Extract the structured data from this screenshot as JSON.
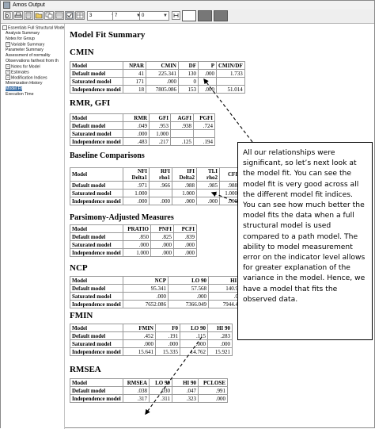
{
  "window": {
    "title": "Amos Output"
  },
  "toolbar": {
    "select1": "3",
    "select2": "7",
    "select3": "0"
  },
  "tree": [
    {
      "label": "Essentials Full Structural Model.a",
      "indent": 0,
      "expander": "-"
    },
    {
      "label": "Analysis Summary",
      "indent": 1,
      "expander": ""
    },
    {
      "label": "Notes for Group",
      "indent": 1,
      "expander": ""
    },
    {
      "label": "Variable Summary",
      "indent": 1,
      "expander": "+"
    },
    {
      "label": "Parameter Summary",
      "indent": 1,
      "expander": ""
    },
    {
      "label": "Assessment of normality",
      "indent": 1,
      "expander": ""
    },
    {
      "label": "Observations farthest from th",
      "indent": 1,
      "expander": ""
    },
    {
      "label": "Notes for Model",
      "indent": 1,
      "expander": "+"
    },
    {
      "label": "Estimates",
      "indent": 1,
      "expander": "+"
    },
    {
      "label": "Modification Indices",
      "indent": 1,
      "expander": "+"
    },
    {
      "label": "Minimization History",
      "indent": 1,
      "expander": ""
    },
    {
      "label": "Model Fit",
      "indent": 1,
      "expander": "",
      "selected": true
    },
    {
      "label": "Execution Time",
      "indent": 1,
      "expander": ""
    }
  ],
  "content": {
    "title": "Model Fit Summary",
    "sections": [
      {
        "heading": "CMIN",
        "columns": [
          "Model",
          "NPAR",
          "CMIN",
          "DF",
          "P",
          "CMIN/DF"
        ],
        "rows": [
          [
            "Default model",
            "41",
            "225.341",
            "130",
            ".000",
            "1.733"
          ],
          [
            "Saturated model",
            "171",
            ".000",
            "0",
            "",
            ""
          ],
          [
            "Independence model",
            "18",
            "7805.086",
            "153",
            ".000",
            "51.014"
          ]
        ]
      },
      {
        "heading": "RMR, GFI",
        "columns": [
          "Model",
          "RMR",
          "GFI",
          "AGFI",
          "PGFI"
        ],
        "rows": [
          [
            "Default model",
            ".049",
            ".953",
            ".938",
            ".724"
          ],
          [
            "Saturated model",
            ".000",
            "1.000",
            "",
            ""
          ],
          [
            "Independence model",
            ".483",
            ".217",
            ".125",
            ".194"
          ]
        ]
      },
      {
        "heading": "Baseline Comparisons",
        "columns": [
          "Model",
          "NFI\nDelta1",
          "RFI\nrho1",
          "IFI\nDelta2",
          "TLI\nrho2",
          "CFI"
        ],
        "rows": [
          [
            "Default model",
            ".971",
            ".966",
            ".988",
            ".985",
            ".988"
          ],
          [
            "Saturated model",
            "1.000",
            "",
            "1.000",
            "",
            "1.000"
          ],
          [
            "Independence model",
            ".000",
            ".000",
            ".000",
            ".000",
            ".000"
          ]
        ]
      },
      {
        "heading": "Parsimony-Adjusted Measures",
        "columns": [
          "Model",
          "PRATIO",
          "PNFI",
          "PCFI"
        ],
        "rows": [
          [
            "Default model",
            ".850",
            ".825",
            ".839"
          ],
          [
            "Saturated model",
            ".000",
            ".000",
            ".000"
          ],
          [
            "Independence model",
            "1.000",
            ".000",
            ".000"
          ]
        ]
      },
      {
        "heading": "NCP",
        "columns": [
          "Model",
          "NCP",
          "LO 90",
          "HI 90"
        ],
        "rows": [
          [
            "Default model",
            "95.341",
            "57.568",
            "140.981"
          ],
          [
            "Saturated model",
            ".000",
            ".000",
            ".000"
          ],
          [
            "Independence model",
            "7652.086",
            "7366.049",
            "7944.441"
          ]
        ]
      },
      {
        "heading": "FMIN",
        "columns": [
          "Model",
          "FMIN",
          "F0",
          "LO 90",
          "HI 90"
        ],
        "rows": [
          [
            "Default model",
            ".452",
            ".191",
            ".115",
            ".283"
          ],
          [
            "Saturated model",
            ".000",
            ".000",
            ".000",
            ".000"
          ],
          [
            "Independence model",
            "15.641",
            "15.335",
            "14.762",
            "15.921"
          ]
        ]
      },
      {
        "heading": "RMSEA",
        "columns": [
          "Model",
          "RMSEA",
          "LO 90",
          "HI 90",
          "PCLOSE"
        ],
        "rows": [
          [
            "Default model",
            ".038",
            ".030",
            ".047",
            ".991"
          ],
          [
            "Independence model",
            ".317",
            ".311",
            ".323",
            ".000"
          ]
        ]
      }
    ]
  },
  "callout": {
    "text": "All our relationships were significant, so let’s next look at the model fit. You can see the model fit is very good across all the different model fit indices. You can see how much better the model fits the data when a full structural model is used compared to a path model. The ability to model measurement error on the indicator level allows for greater explanation of the variance in the model. Hence, we have a model that fits the observed data."
  }
}
